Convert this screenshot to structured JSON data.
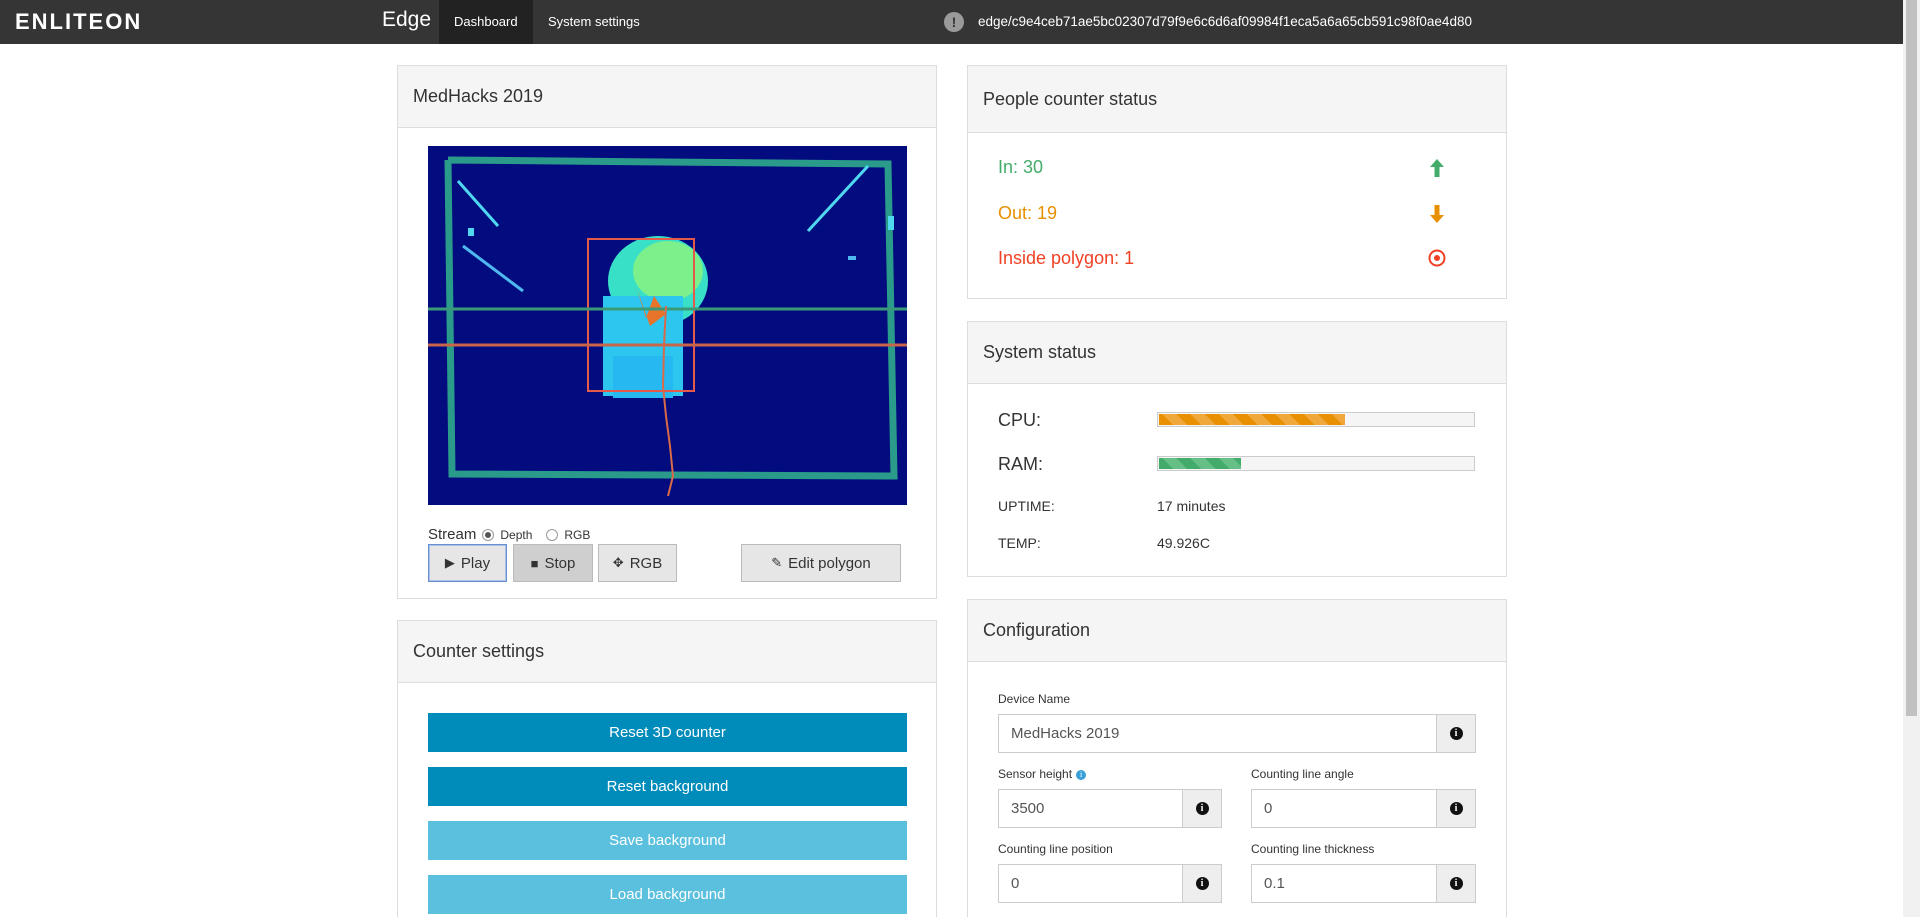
{
  "nav": {
    "brand": "ENLITEON",
    "title": "Edge",
    "links": [
      {
        "label": "Dashboard",
        "active": true
      },
      {
        "label": "System settings",
        "active": false
      }
    ],
    "alert_icon": "exclamation-circle-icon",
    "device_id": "edge/c9e4ceb71ae5bc02307d79f9e6c6d6af09984f1eca5a6a65cb591c98f0ae4d80"
  },
  "camera_panel": {
    "title": "MedHacks 2019",
    "stream_label": "Stream",
    "stream_options": [
      {
        "label": "Depth",
        "checked": true
      },
      {
        "label": "RGB",
        "checked": false
      }
    ],
    "buttons": {
      "play": "Play",
      "stop": "Stop",
      "rgb": "RGB",
      "edit_polygon": "Edit polygon"
    }
  },
  "counter_settings": {
    "title": "Counter settings",
    "buttons": [
      {
        "label": "Reset 3D counter",
        "color": "#008cba"
      },
      {
        "label": "Reset background",
        "color": "#008cba"
      },
      {
        "label": "Save background",
        "color": "#5bc0de"
      },
      {
        "label": "Load background",
        "color": "#5bc0de"
      }
    ]
  },
  "people_counter": {
    "title": "People counter status",
    "in": {
      "label": "In: 30",
      "color": "#43ac6a",
      "icon": "arrow-up-icon"
    },
    "out": {
      "label": "Out: 19",
      "color": "#e99002",
      "icon": "arrow-down-icon"
    },
    "inside": {
      "label": "Inside polygon: 1",
      "color": "#f04124",
      "icon": "target-icon"
    }
  },
  "system_status": {
    "title": "System status",
    "cpu_label": "CPU:",
    "cpu_fraction": 0.59,
    "ram_label": "RAM:",
    "ram_fraction": 0.26,
    "uptime_label": "UPTIME:",
    "uptime_value": "17 minutes",
    "temp_label": "TEMP:",
    "temp_value": "49.926C"
  },
  "configuration": {
    "title": "Configuration",
    "device_name_label": "Device Name",
    "device_name_value": "MedHacks 2019",
    "sensor_height_label": "Sensor height",
    "sensor_height_value": "3500",
    "counting_line_angle_label": "Counting line angle",
    "counting_line_angle_value": "0",
    "counting_line_position_label": "Counting line position",
    "counting_line_position_value": "0",
    "counting_line_thickness_label": "Counting line thickness",
    "counting_line_thickness_value": "0.1"
  }
}
